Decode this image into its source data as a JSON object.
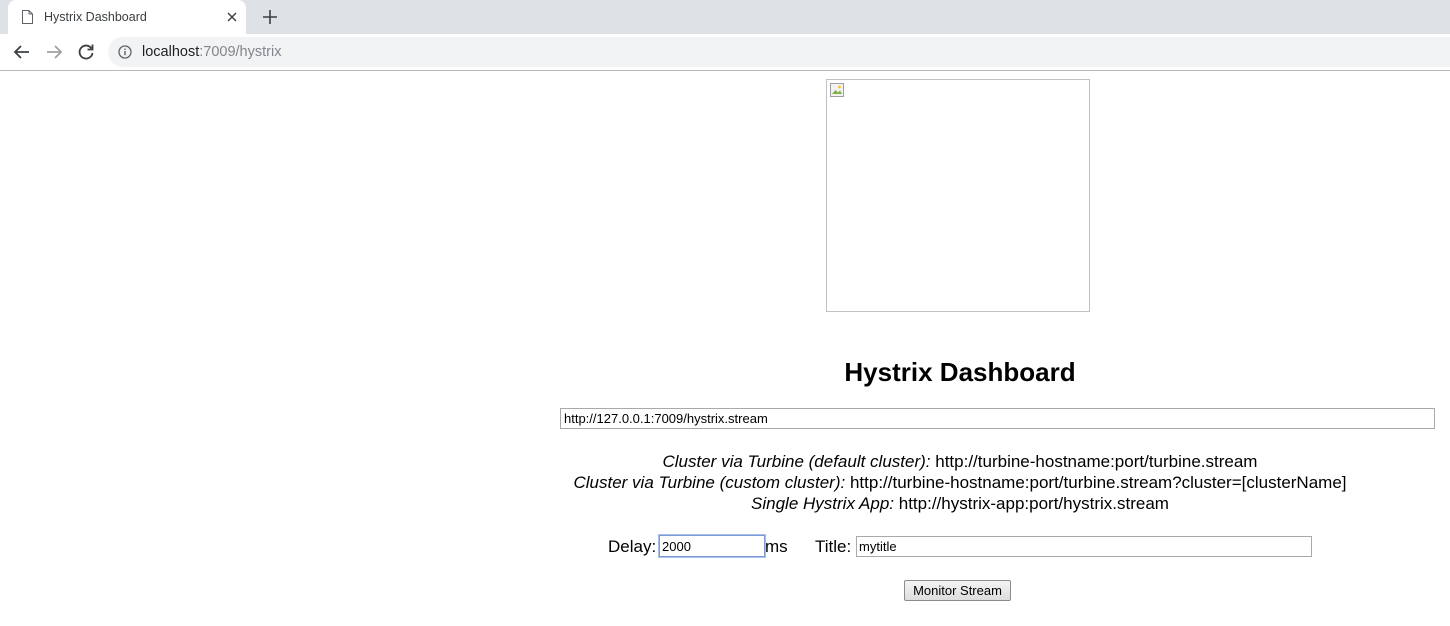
{
  "browser": {
    "tab_title": "Hystrix Dashboard",
    "url_host": "localhost",
    "url_rest": ":7009/hystrix"
  },
  "page": {
    "heading": "Hystrix Dashboard",
    "stream_url_value": "http://127.0.0.1:7009/hystrix.stream",
    "hints": [
      {
        "label": "Cluster via Turbine (default cluster):",
        "value": "http://turbine-hostname:port/turbine.stream"
      },
      {
        "label": "Cluster via Turbine (custom cluster):",
        "value": "http://turbine-hostname:port/turbine.stream?cluster=[clusterName]"
      },
      {
        "label": "Single Hystrix App:",
        "value": "http://hystrix-app:port/hystrix.stream"
      }
    ],
    "delay_label": "Delay:",
    "delay_value": "2000",
    "delay_unit": "ms",
    "title_label": "Title:",
    "title_value": "mytitle",
    "monitor_button": "Monitor Stream"
  },
  "icons": {
    "tab": "page-icon",
    "tab_close": "close-icon",
    "new_tab": "plus-icon",
    "back": "back-arrow-icon",
    "forward": "forward-arrow-icon",
    "reload": "reload-icon",
    "site_info": "info-icon",
    "logo": "broken-image-icon"
  }
}
